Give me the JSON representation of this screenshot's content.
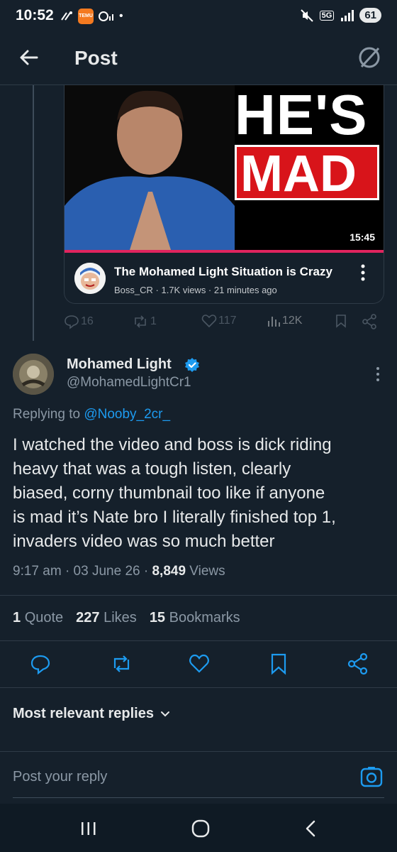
{
  "status_bar": {
    "time": "10:52",
    "network": "5G",
    "battery": "61",
    "temu_label": "TEMU"
  },
  "header": {
    "title": "Post"
  },
  "quoted_video": {
    "thumb_line1": "HE'S",
    "thumb_line2": "MAD",
    "duration": "15:45",
    "title": "The Mohamed Light Situation is Crazy",
    "meta": "Boss_CR · 1.7K views · 21 minutes ago"
  },
  "parent_actions": {
    "replies": "16",
    "reposts": "1",
    "likes": "117",
    "views": "12K"
  },
  "tweet": {
    "author_name": "Mohamed Light",
    "handle": "@MohamedLightCr1",
    "replying_prefix": "Replying to ",
    "replying_to": "@Nooby_2cr_",
    "body_lines": [
      "I watched the video and boss is dick riding",
      "heavy that was a tough listen, clearly",
      "biased, corny thumbnail too like if anyone",
      "is mad it’s Nate bro I literally finished top 1,",
      "invaders video was so much better"
    ],
    "time": "9:17 am",
    "date": "03 June 26",
    "views_count": "8,849",
    "views_label": "Views"
  },
  "stats": {
    "quotes_count": "1",
    "quotes_label": "Quote",
    "likes_count": "227",
    "likes_label": "Likes",
    "bookmarks_count": "15",
    "bookmarks_label": "Bookmarks"
  },
  "replies_sort": "Most relevant replies",
  "reply_bar": {
    "placeholder": "Post your reply"
  },
  "colors": {
    "background": "#15202b",
    "accent": "#1d9bf0",
    "text_secondary": "#8b98a5"
  }
}
